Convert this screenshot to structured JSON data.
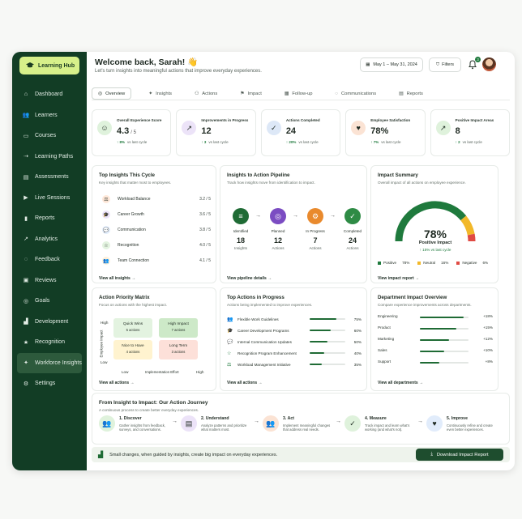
{
  "sidebar": {
    "brand": "Learning Hub",
    "items": [
      {
        "label": "Dashboard",
        "icon": "home-icon"
      },
      {
        "label": "Learners",
        "icon": "users-icon"
      },
      {
        "label": "Courses",
        "icon": "book-icon"
      },
      {
        "label": "Learning Paths",
        "icon": "path-icon"
      },
      {
        "label": "Assessments",
        "icon": "clipboard-icon"
      },
      {
        "label": "Live Sessions",
        "icon": "video-icon"
      },
      {
        "label": "Reports",
        "icon": "bar-chart-icon"
      },
      {
        "label": "Analytics",
        "icon": "line-chart-icon"
      },
      {
        "label": "Feedback",
        "icon": "chat-icon"
      },
      {
        "label": "Reviews",
        "icon": "review-icon"
      },
      {
        "label": "Goals",
        "icon": "target-icon"
      },
      {
        "label": "Development",
        "icon": "growth-icon"
      },
      {
        "label": "Recognition",
        "icon": "star-icon"
      },
      {
        "label": "Workforce Insights",
        "icon": "bulb-icon"
      },
      {
        "label": "Settings",
        "icon": "gear-icon"
      }
    ]
  },
  "header": {
    "title": "Welcome back, Sarah! 👋",
    "subtitle": "Let's turn insights into meaningful actions that improve everyday experiences.",
    "date_range": "May 1 – May 31, 2024",
    "filters_label": "Filters",
    "notification_count": "3"
  },
  "tabs": [
    "Overview",
    "Insights",
    "Actions",
    "Impact",
    "Follow-up",
    "Communications",
    "Reports"
  ],
  "kpis": [
    {
      "label": "Overall Experience Score",
      "value": "4.3",
      "suffix": "/ 5",
      "trend": "↑ 8%",
      "trend_text": "vs last cycle",
      "color": "#dff2dc",
      "icon": "smile-icon",
      "glyph": "☺"
    },
    {
      "label": "Improvements in Progress",
      "value": "12",
      "suffix": "",
      "trend": "↑ 3",
      "trend_text": "vs last cycle",
      "color": "#ece3f8",
      "icon": "trend-up-icon",
      "glyph": "↗"
    },
    {
      "label": "Actions Completed",
      "value": "24",
      "suffix": "",
      "trend": "↑ 20%",
      "trend_text": "vs last cycle",
      "color": "#dde8f7",
      "icon": "check-circle-icon",
      "glyph": "✓"
    },
    {
      "label": "Employee Satisfaction",
      "value": "78%",
      "suffix": "",
      "trend": "↑ 7%",
      "trend_text": "vs last cycle",
      "color": "#fbe3d4",
      "icon": "heart-icon",
      "glyph": "♥"
    },
    {
      "label": "Positive Impact Areas",
      "value": "8",
      "suffix": "",
      "trend": "↑ 2",
      "trend_text": "vs last cycle",
      "color": "#dff2dc",
      "icon": "arrow-up-icon",
      "glyph": "↗"
    }
  ],
  "top_insights": {
    "title": "Top Insights This Cycle",
    "subtitle": "Key insights that matter most to employees.",
    "rows": [
      {
        "label": "Workload Balance",
        "score": "3.2 / 5",
        "color": "#ffe8d9",
        "glyph": "⚖",
        "icon": "balance-icon"
      },
      {
        "label": "Career Growth",
        "score": "3.6 / 5",
        "color": "#ece3f8",
        "glyph": "🎓",
        "icon": "graduation-icon"
      },
      {
        "label": "Communication",
        "score": "3.8 / 5",
        "color": "#e1ecfb",
        "glyph": "💬",
        "icon": "chat-icon"
      },
      {
        "label": "Recognition",
        "score": "4.0 / 5",
        "color": "#e3f3e0",
        "glyph": "☆",
        "icon": "star-icon"
      },
      {
        "label": "Team Connection",
        "score": "4.1 / 5",
        "color": "#fff0d8",
        "glyph": "👥",
        "icon": "team-icon"
      }
    ],
    "link": "View all insights →"
  },
  "pipeline": {
    "title": "Insights to Action Pipeline",
    "subtitle": "Track how insights move from identification to impact.",
    "steps": [
      {
        "label": "Identified",
        "count": "18",
        "unit": "Insights",
        "color": "#1f6b35",
        "glyph": "≡",
        "icon": "list-icon"
      },
      {
        "label": "Planned",
        "count": "12",
        "unit": "Actions",
        "color": "#7b4cc2",
        "glyph": "◎",
        "icon": "target-icon"
      },
      {
        "label": "In Progress",
        "count": "7",
        "unit": "Actions",
        "color": "#e98a2d",
        "glyph": "⚙",
        "icon": "gear-icon"
      },
      {
        "label": "Completed",
        "count": "24",
        "unit": "Actions",
        "color": "#2e8b45",
        "glyph": "✓",
        "icon": "check-icon"
      }
    ],
    "link": "View pipeline details →"
  },
  "impact": {
    "title": "Impact Summary",
    "subtitle": "Overall impact of all actions on employee experience.",
    "value": "78%",
    "label": "Positive Impact",
    "trend": "↑ 15% vs last cycle",
    "legend": [
      {
        "label": "Positive",
        "value": "78%",
        "color": "#1f7a3d"
      },
      {
        "label": "Neutral",
        "value": "16%",
        "color": "#f2b829"
      },
      {
        "label": "Negative",
        "value": "6%",
        "color": "#e04a43"
      }
    ],
    "link": "View impact report →"
  },
  "matrix": {
    "title": "Action Priority Matrix",
    "subtitle": "Focus on actions with the highest impact.",
    "y_label": "Employee Impact",
    "x_label": "Implementation Effort",
    "high": "High",
    "low": "Low",
    "cells": [
      {
        "name": "Quick Wins",
        "count": "5 actions",
        "color": "#e3f3e0"
      },
      {
        "name": "High Impact",
        "count": "7 actions",
        "color": "#cde9c8"
      },
      {
        "name": "Nice to Have",
        "count": "4 actions",
        "color": "#fff3cf"
      },
      {
        "name": "Long Term",
        "count": "3 actions",
        "color": "#fde0d9"
      }
    ],
    "link": "View all actions →"
  },
  "top_actions": {
    "title": "Top Actions in Progress",
    "subtitle": "Actions being implemented to improve experiences.",
    "rows": [
      {
        "label": "Flexible Work Guidelines",
        "value": "75%",
        "progress": 75,
        "glyph": "👥",
        "icon": "people-icon"
      },
      {
        "label": "Career Development Programs",
        "value": "60%",
        "progress": 60,
        "glyph": "🎓",
        "icon": "graduation-icon"
      },
      {
        "label": "Internal Communication Updates",
        "value": "50%",
        "progress": 50,
        "glyph": "💬",
        "icon": "chat-icon"
      },
      {
        "label": "Recognition Program Enhancement",
        "value": "40%",
        "progress": 40,
        "glyph": "☆",
        "icon": "star-icon"
      },
      {
        "label": "Workload Management Initiative",
        "value": "35%",
        "progress": 35,
        "glyph": "⚖",
        "icon": "balance-icon"
      }
    ],
    "link": "View all actions →"
  },
  "departments": {
    "title": "Department Impact Overview",
    "subtitle": "Compare experience improvements across departments.",
    "rows": [
      {
        "label": "Engineering",
        "value": "+18%",
        "progress": 90
      },
      {
        "label": "Product",
        "value": "+15%",
        "progress": 75
      },
      {
        "label": "Marketing",
        "value": "+12%",
        "progress": 60
      },
      {
        "label": "Sales",
        "value": "+10%",
        "progress": 50
      },
      {
        "label": "Support",
        "value": "+8%",
        "progress": 40
      }
    ],
    "link": "View all departments →"
  },
  "journey": {
    "title": "From Insight to Impact: Our Action Journey",
    "subtitle": "A continuous process to create better everyday experiences.",
    "steps": [
      {
        "title": "1. Discover",
        "desc": "Gather insights from feedback, surveys, and conversations.",
        "color": "#dff2dc",
        "glyph": "👥",
        "icon": "discover-icon"
      },
      {
        "title": "2. Understand",
        "desc": "Analyze patterns and prioritize what matters most.",
        "color": "#ece3f8",
        "glyph": "▤",
        "icon": "document-icon"
      },
      {
        "title": "3. Act",
        "desc": "Implement meaningful changes that address real needs.",
        "color": "#fbe3d4",
        "glyph": "👥",
        "icon": "act-icon"
      },
      {
        "title": "4. Measure",
        "desc": "Track impact and learn what's working (and what's not).",
        "color": "#dff2dc",
        "glyph": "✓",
        "icon": "measure-icon"
      },
      {
        "title": "5. Improve",
        "desc": "Continuously refine and create even better experiences.",
        "color": "#e1ecfb",
        "glyph": "♥",
        "icon": "improve-icon"
      }
    ]
  },
  "banner": {
    "text": "Small changes, when guided by insights, create big impact on everyday experiences.",
    "button": "Download Impact Report"
  }
}
